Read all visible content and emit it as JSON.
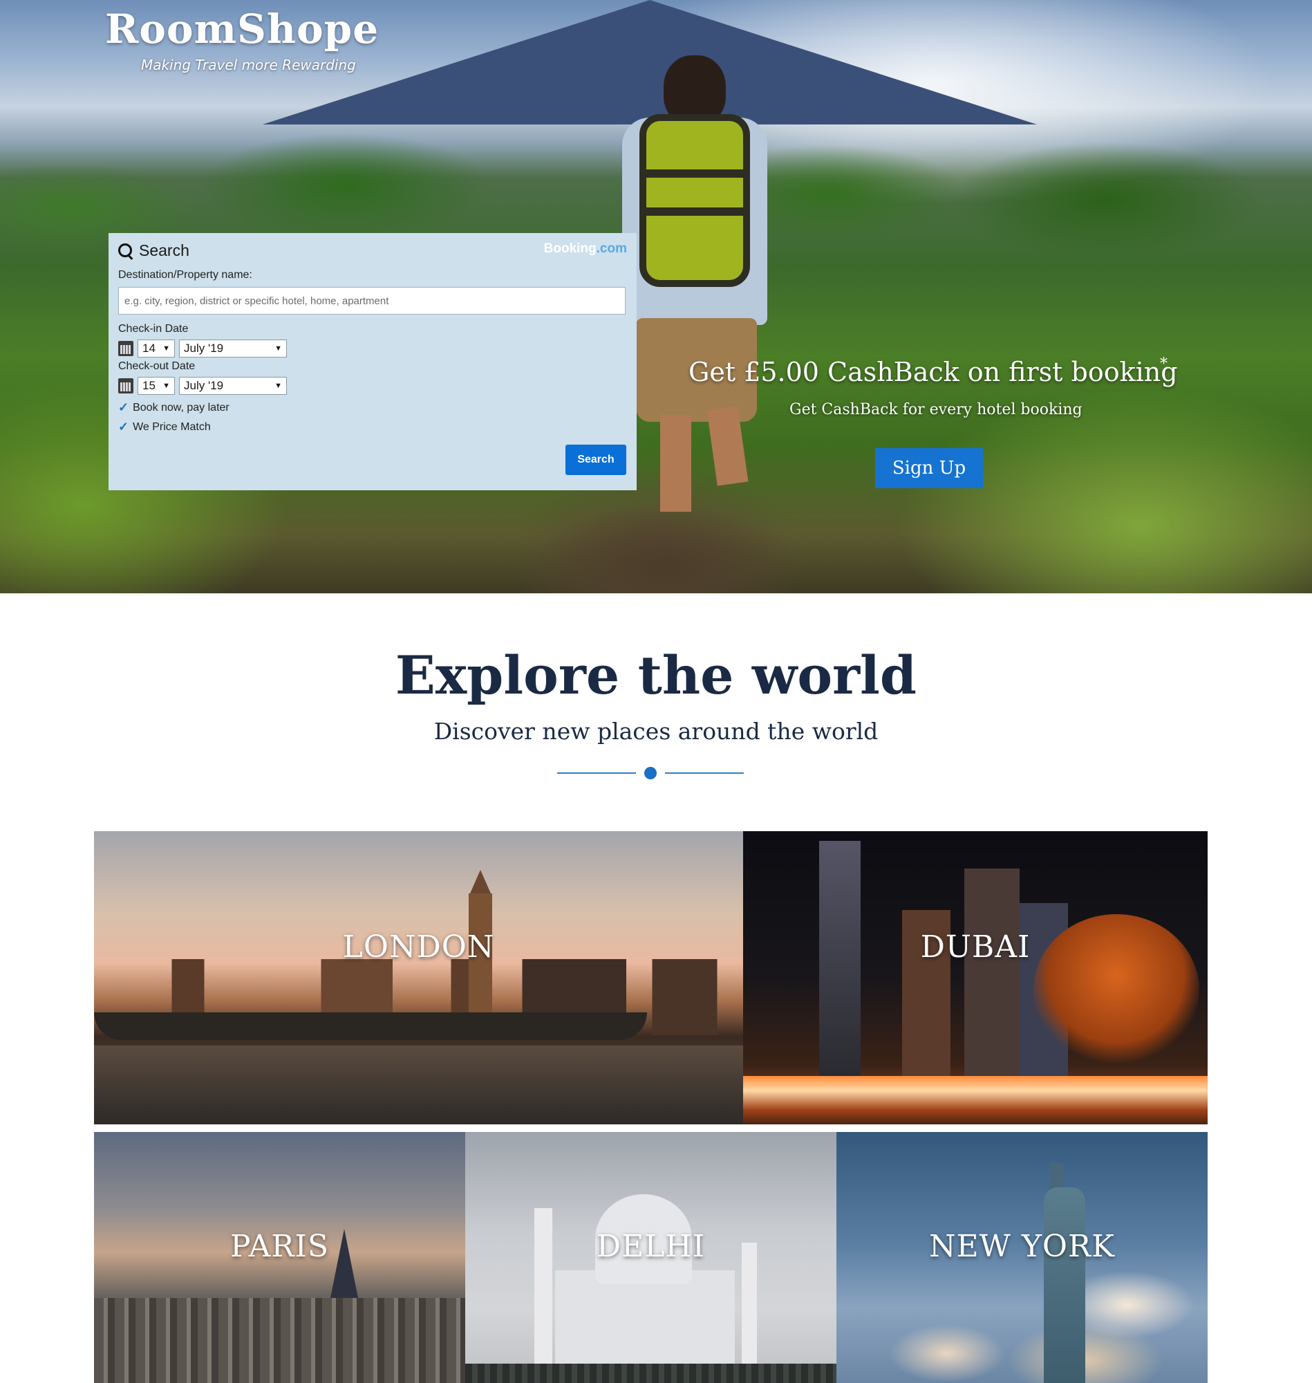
{
  "brand": {
    "name": "RoomShope",
    "tagline": "Making Travel more Rewarding"
  },
  "search_widget": {
    "title": "Search",
    "partner_logo_main": "Booking",
    "partner_logo_suffix": ".com",
    "destination_label": "Destination/Property name:",
    "destination_placeholder": "e.g. city, region, district or specific hotel, home, apartment",
    "destination_value": "",
    "checkin_label": "Check-in Date",
    "checkin_day": "14",
    "checkin_month": "July '19",
    "checkout_label": "Check-out Date",
    "checkout_day": "15",
    "checkout_month": "July '19",
    "features": [
      "Book now, pay later",
      "We Price Match"
    ],
    "search_button": "Search"
  },
  "promo": {
    "title": "Get £5.00 CashBack on first booking",
    "asterisk": "*",
    "subtitle": "Get CashBack for every hotel booking",
    "signup_button": "Sign Up"
  },
  "explore": {
    "title": "Explore the world",
    "subtitle": "Discover new places around the world"
  },
  "cities": [
    "LONDON",
    "DUBAI",
    "PARIS",
    "DELHI",
    "NEW YORK"
  ],
  "colors": {
    "accent_blue": "#1673d2",
    "widget_bg": "#cde0eb",
    "heading_navy": "#1b2a44"
  }
}
